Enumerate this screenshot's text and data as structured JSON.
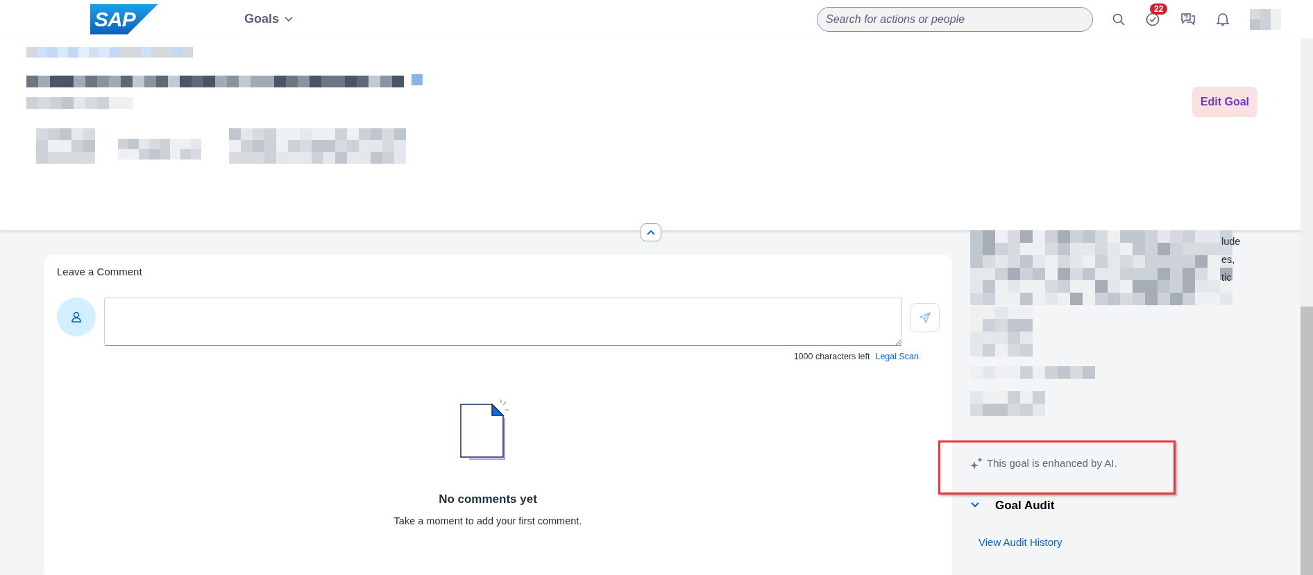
{
  "header": {
    "logo": "SAP",
    "menu": {
      "label": "Goals"
    },
    "search": {
      "placeholder": "Search for actions or people"
    },
    "todo_badge": "22"
  },
  "goal_panel": {
    "edit_button": "Edit Goal"
  },
  "comments": {
    "title": "Leave a Comment",
    "counter": "1000 characters left",
    "legal_scan": "Legal Scan",
    "empty_title": "No comments yet",
    "empty_text": "Take a moment to add your first comment."
  },
  "details": {
    "fragments": [
      "lude",
      "es,",
      "tic"
    ],
    "ai_note": "This goal is enhanced by AI.",
    "audit": {
      "title": "Goal Audit",
      "expanded": true,
      "link": "View Audit History"
    }
  }
}
